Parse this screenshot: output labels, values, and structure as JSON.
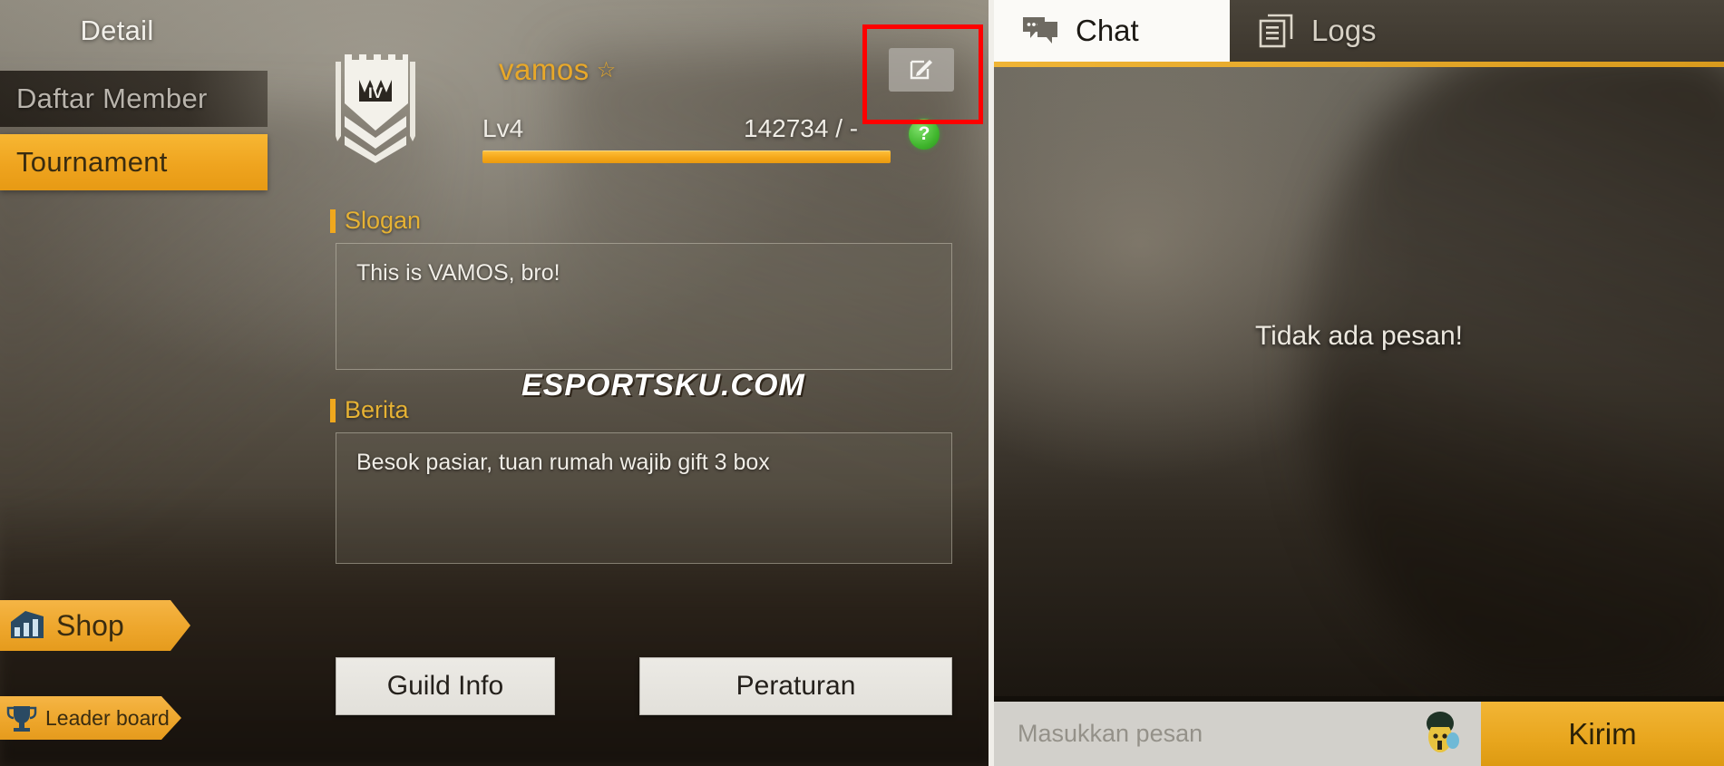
{
  "nav": {
    "items": [
      {
        "id": "detail",
        "label": "Detail",
        "state": "header"
      },
      {
        "id": "daftar-member",
        "label": "Daftar Member",
        "state": "normal"
      },
      {
        "id": "tournament",
        "label": "Tournament",
        "state": "selected"
      }
    ],
    "banners": [
      {
        "id": "shop",
        "label": "Shop",
        "icon": "shop-icon"
      },
      {
        "id": "leader-board",
        "label": "Leader board",
        "icon": "trophy-icon"
      }
    ]
  },
  "guild": {
    "emblem_icon": "guild-emblem-shield-icon",
    "name": "vamos",
    "name_star": "☆",
    "level": "Lv4",
    "exp_text": "142734 / -",
    "exp_percent": 100,
    "help_icon": "help-question-icon",
    "edit_icon": "edit-pencil-icon",
    "accent_color": "#efa41f",
    "name_color": "#e8a82a",
    "highlight_color": "#ff0000"
  },
  "fields": {
    "slogan": {
      "label": "Slogan",
      "value": "This is VAMOS, bro!"
    },
    "berita": {
      "label": "Berita",
      "value": "Besok pasiar, tuan rumah wajib gift 3 box"
    }
  },
  "actions": {
    "guild_info": "Guild Info",
    "peraturan": "Peraturan"
  },
  "watermark": "ESPORTSKU.COM",
  "chat": {
    "tabs": [
      {
        "id": "chat",
        "label": "Chat",
        "icon": "speech-bubble-icon",
        "active": true
      },
      {
        "id": "logs",
        "label": "Logs",
        "icon": "document-copy-icon",
        "active": false
      }
    ],
    "empty_message": "Tidak ada pesan!",
    "input": {
      "value": "",
      "placeholder": "Masukkan pesan",
      "emoji_icon": "emoji-avatar-icon"
    },
    "send_label": "Kirim"
  }
}
